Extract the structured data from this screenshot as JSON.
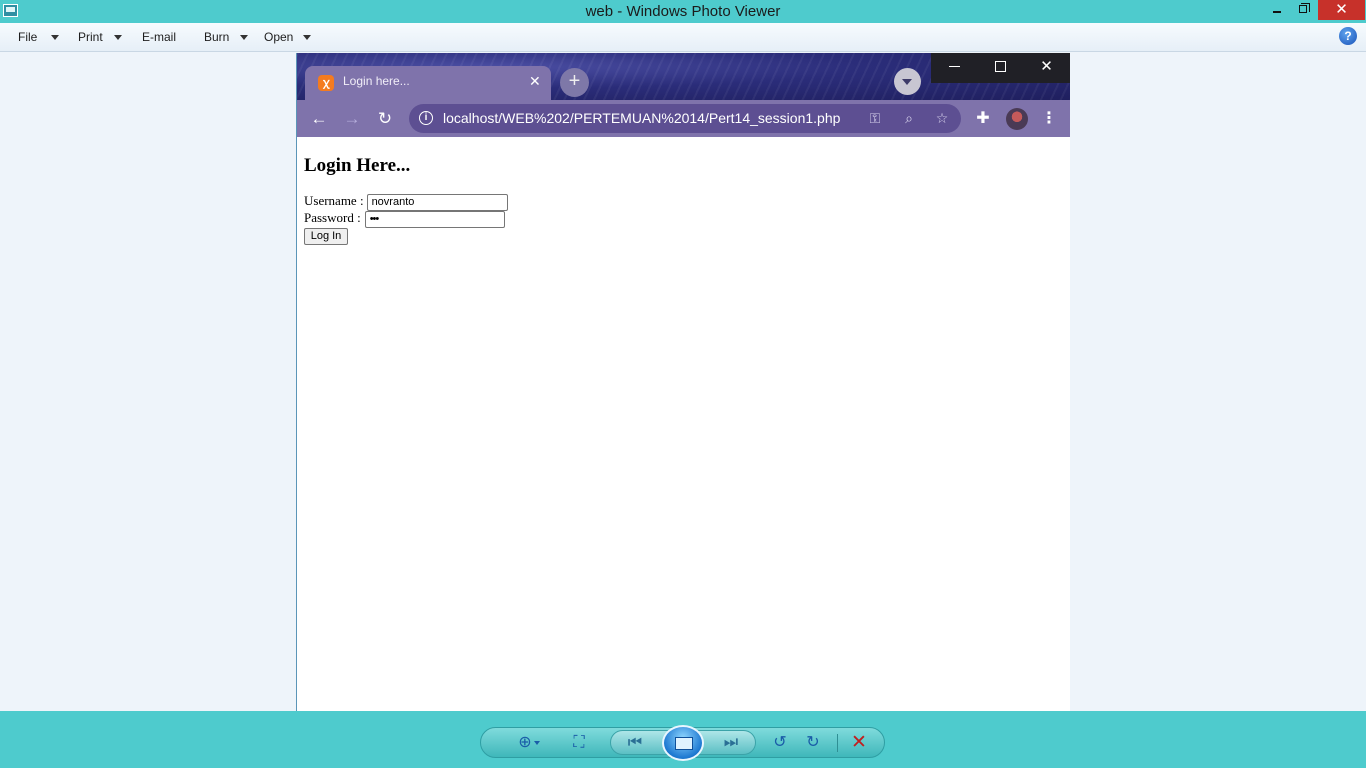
{
  "photo_viewer": {
    "window_title": "web - Windows Photo Viewer",
    "menu": {
      "file": "File",
      "print": "Print",
      "email": "E-mail",
      "burn": "Burn",
      "open": "Open"
    },
    "help_glyph": "?",
    "controls": {
      "zoom": "zoom-icon",
      "fit": "actual-size-icon",
      "previous": "previous-icon",
      "slideshow": "slideshow-icon",
      "next": "next-icon",
      "rotate_left": "rotate-counterclockwise-icon",
      "rotate_right": "rotate-clockwise-icon",
      "delete": "delete-icon"
    }
  },
  "browser": {
    "tab_title": "Login here...",
    "url": "localhost/WEB%202/PERTEMUAN%2014/Pert14_session1.php",
    "theme_color": "#7f73ab",
    "omnibox_color": "#5d4f92"
  },
  "page": {
    "heading": "Login Here...",
    "username_label": "Username :",
    "username_value": "novranto",
    "password_label": "Password :",
    "password_value": "•••",
    "login_button": "Log In"
  },
  "colors": {
    "viewer_accent": "#4ecbcd",
    "delete_red": "#c11e1e"
  }
}
